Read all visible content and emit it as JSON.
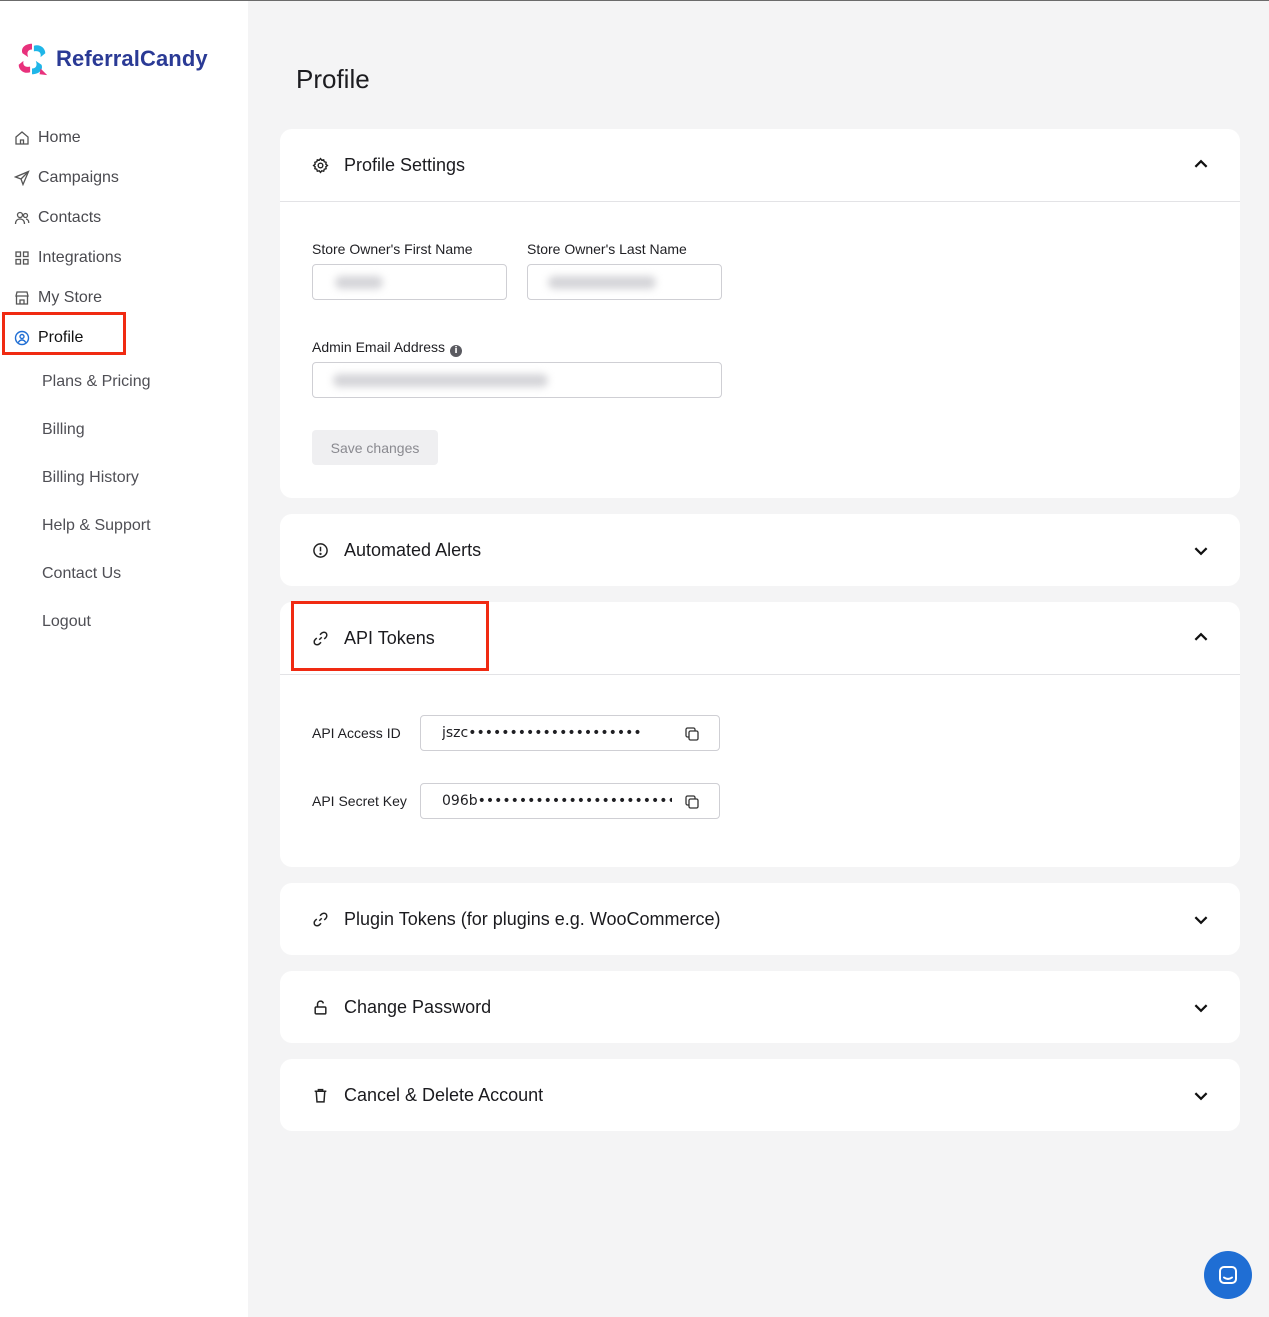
{
  "app": {
    "brand": "ReferralCandy",
    "brand_color": "#2a3a95",
    "highlight_color": "#f02a12"
  },
  "sidebar": {
    "nav": [
      {
        "label": "Home",
        "icon": "home-icon"
      },
      {
        "label": "Campaigns",
        "icon": "send-icon"
      },
      {
        "label": "Contacts",
        "icon": "users-icon"
      },
      {
        "label": "Integrations",
        "icon": "grid-icon"
      },
      {
        "label": "My Store",
        "icon": "store-icon"
      },
      {
        "label": "Profile",
        "icon": "user-circle-icon",
        "active": true
      }
    ],
    "sub": [
      {
        "label": "Plans & Pricing"
      },
      {
        "label": "Billing"
      },
      {
        "label": "Billing History"
      },
      {
        "label": "Help & Support"
      },
      {
        "label": "Contact Us"
      },
      {
        "label": "Logout"
      }
    ]
  },
  "main": {
    "title": "Profile",
    "profile_settings": {
      "title": "Profile Settings",
      "icon": "gear-icon",
      "expanded": true,
      "first_name_label": "Store Owner's First Name",
      "last_name_label": "Store Owner's Last Name",
      "email_label": "Admin Email Address",
      "info_icon": "info-icon",
      "save_label": "Save changes"
    },
    "automated_alerts": {
      "title": "Automated Alerts",
      "icon": "alert-circle-icon",
      "expanded": false
    },
    "api_tokens": {
      "title": "API Tokens",
      "icon": "link-icon",
      "expanded": true,
      "access_id_label": "API Access ID",
      "access_id_value": "jszc•••••••••••••••••••••",
      "secret_key_label": "API Secret Key",
      "secret_key_value": "096b••••••••••••••••••••••••••"
    },
    "plugin_tokens": {
      "title": "Plugin Tokens (for plugins e.g. WooCommerce)",
      "icon": "link-icon",
      "expanded": false
    },
    "change_password": {
      "title": "Change Password",
      "icon": "lock-icon",
      "expanded": false
    },
    "cancel_delete": {
      "title": "Cancel & Delete Account",
      "icon": "trash-icon",
      "expanded": false
    }
  },
  "chat": {
    "icon": "chat-icon"
  }
}
